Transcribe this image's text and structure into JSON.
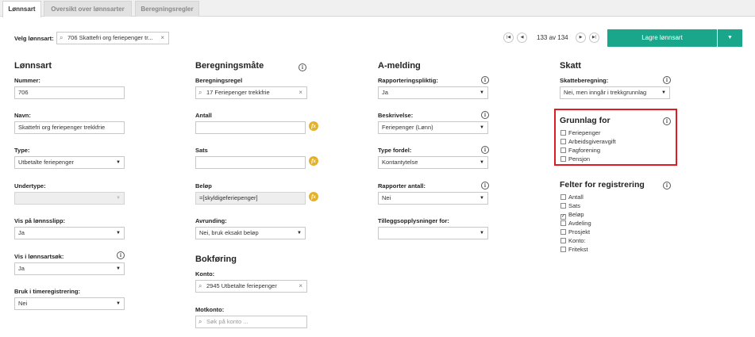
{
  "tabs": [
    {
      "label": "Lønnsart"
    },
    {
      "label": "Oversikt over lønnsarter"
    },
    {
      "label": "Beregningsregler"
    }
  ],
  "toolbar": {
    "select_label": "Velg lønnsart:",
    "select_value": "706 Skattefri org feriepenger tr...",
    "pagination": "133 av 134",
    "save_label": "Lagre lønnsart",
    "save_dropdown_icon": "caret-down-icon"
  },
  "lonnsart": {
    "title": "Lønnsart",
    "nummer_label": "Nummer:",
    "nummer_value": "706",
    "navn_label": "Navn:",
    "navn_value": "Skattefri org feriepenger trekkfrie",
    "type_label": "Type:",
    "type_value": "Utbetalte feriepenger",
    "undertype_label": "Undertype:",
    "undertype_value": "",
    "vis_lonnsslipp_label": "Vis på lønnsslipp:",
    "vis_lonnsslipp_value": "Ja",
    "vis_lonnsartsok_label": "Vis i lønnsartsøk:",
    "vis_lonnsartsok_value": "Ja",
    "bruk_timereg_label": "Bruk i timeregistrering:",
    "bruk_timereg_value": "Nei"
  },
  "beregning": {
    "title": "Beregningsmåte",
    "regel_label": "Beregningsregel",
    "regel_value": "17 Feriepenger trekkfrie",
    "antall_label": "Antall",
    "antall_value": "",
    "sats_label": "Sats",
    "sats_value": "",
    "belop_label": "Beløp",
    "belop_value": "=[skyldigeferiepenger]",
    "avrunding_label": "Avrunding:",
    "avrunding_value": "Nei, bruk eksakt beløp",
    "fx_symbol": "fx"
  },
  "bokforing": {
    "title": "Bokføring",
    "konto_label": "Konto:",
    "konto_value": "2945 Utbetalte feriepenger",
    "motkonto_label": "Motkonto:",
    "motkonto_placeholder": "Søk på konto ..."
  },
  "amelding": {
    "title": "A-melding",
    "rapporteringspliktig_label": "Rapporteringspliktig:",
    "rapporteringspliktig_value": "Ja",
    "beskrivelse_label": "Beskrivelse:",
    "beskrivelse_value": "Feriepenger (Lønn)",
    "type_fordel_label": "Type fordel:",
    "type_fordel_value": "Kontantytelse",
    "rapporter_antall_label": "Rapporter antall:",
    "rapporter_antall_value": "Nei",
    "tilleggs_label": "Tilleggsopplysninger for:",
    "tilleggs_value": ""
  },
  "skatt": {
    "title": "Skatt",
    "skatteberegning_label": "Skatteberegning:",
    "skatteberegning_value": "Nei, men inngår i trekkgrunnlag"
  },
  "grunnlag": {
    "title": "Grunnlag for",
    "items": [
      {
        "label": "Feriepenger",
        "checked": false
      },
      {
        "label": "Arbeidsgiveravgift",
        "checked": false
      },
      {
        "label": "Fagforening",
        "checked": false
      },
      {
        "label": "Pensjon",
        "checked": false
      }
    ],
    "highlight_color": "#e01b24"
  },
  "felter": {
    "title": "Felter for registrering",
    "items": [
      {
        "label": "Antall",
        "checked": false
      },
      {
        "label": "Sats",
        "checked": false
      },
      {
        "label": "Beløp",
        "checked": true,
        "mark": "✓"
      },
      {
        "label": "Avdeling",
        "checked": false
      },
      {
        "label": "Prosjekt",
        "checked": false
      },
      {
        "label": "Konto:",
        "checked": false
      },
      {
        "label": "Fritekst",
        "checked": false
      }
    ]
  },
  "colors": {
    "accent": "#1aa68a",
    "fx": "#e3b22a",
    "highlight": "#e01b24"
  }
}
